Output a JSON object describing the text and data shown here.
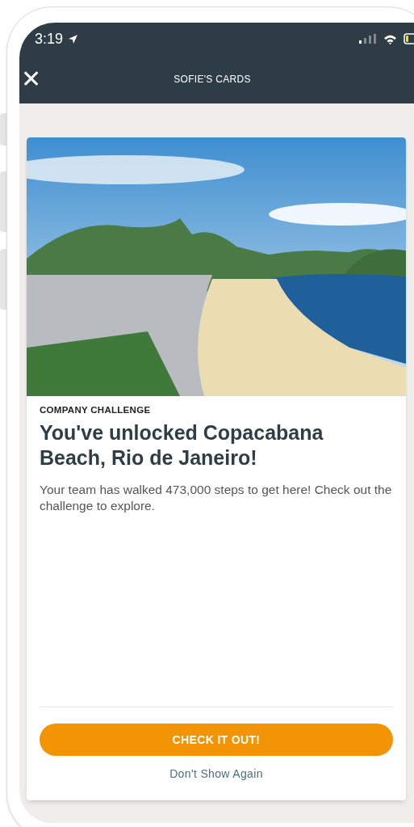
{
  "status_bar": {
    "time": "3:19"
  },
  "header": {
    "close_icon": "✕",
    "title": "SOFIE'S CARDS"
  },
  "card": {
    "category": "COMPANY CHALLENGE",
    "title": "You've unlocked Copacabana Beach, Rio de Janeiro!",
    "body": "Your team has walked 473,000 steps to get here! Check out the challenge to explore.",
    "primary_button": "CHECK IT OUT!",
    "secondary_link": "Don't Show Again"
  }
}
